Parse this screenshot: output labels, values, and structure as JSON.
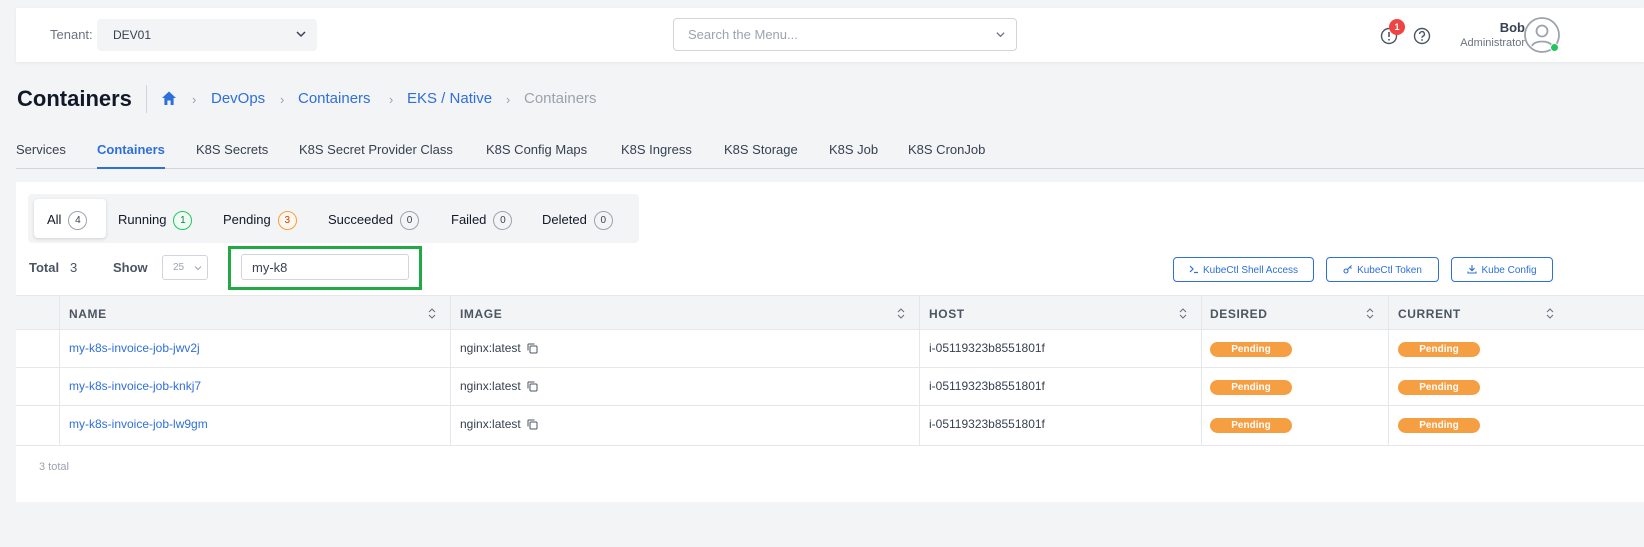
{
  "header": {
    "tenant_label": "Tenant:",
    "tenant_value": "DEV01",
    "search_placeholder": "Search the Menu...",
    "alert_count": "1",
    "user_name": "Bob",
    "user_role": "Administrator"
  },
  "page": {
    "title": "Containers",
    "breadcrumb": [
      "DevOps",
      "Containers",
      "EKS / Native",
      "Containers"
    ]
  },
  "tabs": [
    {
      "label": "Services",
      "active": false
    },
    {
      "label": "Containers",
      "active": true
    },
    {
      "label": "K8S Secrets",
      "active": false
    },
    {
      "label": "K8S Secret Provider Class",
      "active": false
    },
    {
      "label": "K8S Config Maps",
      "active": false
    },
    {
      "label": "K8S Ingress",
      "active": false
    },
    {
      "label": "K8S Storage",
      "active": false
    },
    {
      "label": "K8S Job",
      "active": false
    },
    {
      "label": "K8S CronJob",
      "active": false
    }
  ],
  "filters": [
    {
      "label": "All",
      "count": "4"
    },
    {
      "label": "Running",
      "count": "1"
    },
    {
      "label": "Pending",
      "count": "3"
    },
    {
      "label": "Succeeded",
      "count": "0"
    },
    {
      "label": "Failed",
      "count": "0"
    },
    {
      "label": "Deleted",
      "count": "0"
    }
  ],
  "toolbar": {
    "total_label": "Total",
    "total_value": "3",
    "show_label": "Show",
    "show_value": "25",
    "filter_value": "my-k8",
    "buttons": [
      "KubeCtl Shell Access",
      "KubeCtl Token",
      "Kube Config"
    ]
  },
  "table": {
    "columns": [
      "NAME",
      "IMAGE",
      "HOST",
      "DESIRED",
      "CURRENT"
    ],
    "rows": [
      {
        "name": "my-k8s-invoice-job-jwv2j",
        "image": "nginx:latest",
        "host": "i-05119323b8551801f",
        "desired": "Pending",
        "current": "Pending"
      },
      {
        "name": "my-k8s-invoice-job-knkj7",
        "image": "nginx:latest",
        "host": "i-05119323b8551801f",
        "desired": "Pending",
        "current": "Pending"
      },
      {
        "name": "my-k8s-invoice-job-lw9gm",
        "image": "nginx:latest",
        "host": "i-05119323b8551801f",
        "desired": "Pending",
        "current": "Pending"
      }
    ],
    "footer": "3 total"
  },
  "colors": {
    "accent": "#2f6fdb",
    "pending": "#f59e42",
    "running": "#22c55e",
    "highlight": "#22a845"
  }
}
